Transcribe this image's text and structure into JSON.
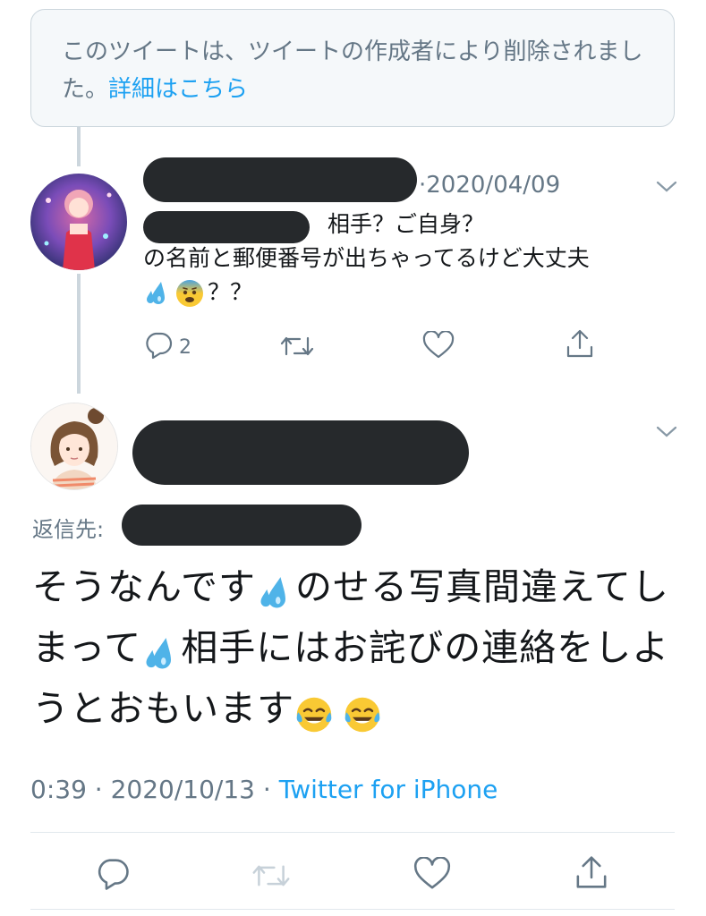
{
  "deleted_notice": {
    "text": "このツイートは、ツイートの作成者により削除されました。",
    "link": "詳細はこちら"
  },
  "tweet1": {
    "date_sep": "·",
    "date": "2020/04/09",
    "text_line1": "相手？ご自身？",
    "text_line2": "の名前と郵便番号が出ちゃってるけど大丈夫",
    "text_line3_tail": "？？",
    "reply_count": "2",
    "icons": [
      "chevron-down-icon",
      "reply-icon",
      "retweet-icon",
      "like-icon",
      "share-icon",
      "sweat-droplets-emoji",
      "fearful-face-emoji"
    ]
  },
  "main_tweet": {
    "reply_to_label": "返信先:",
    "text_part1": "そうなんです",
    "text_part2": "のせる写真間違えてしまって",
    "text_part3": "相手にはお詫びの連絡をしようとおもいます",
    "time": "0:39",
    "sep1": "·",
    "date": "2020/10/13",
    "sep2": "·",
    "source": "Twitter for iPhone",
    "icons": [
      "chevron-down-icon",
      "reply-icon",
      "retweet-icon",
      "like-icon",
      "share-icon",
      "sweat-droplets-emoji",
      "tears-of-joy-emoji"
    ]
  },
  "colors": {
    "text": "#14171a",
    "muted": "#657786",
    "link": "#1da1f2",
    "border": "#ccd6dd",
    "redaction": "#26292c"
  }
}
